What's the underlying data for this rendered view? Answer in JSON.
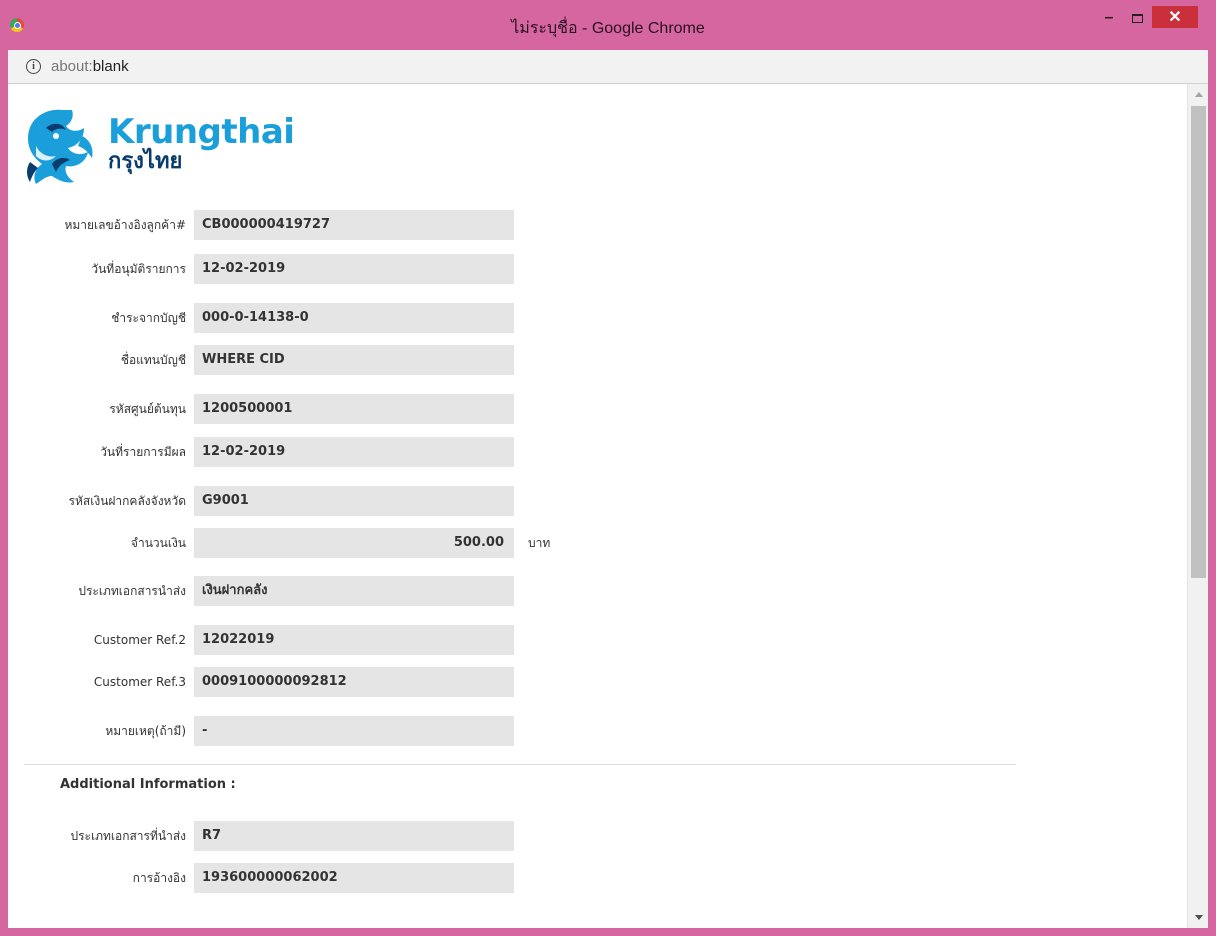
{
  "window": {
    "title": "ไม่ระบุชื่อ - Google Chrome",
    "minimize": "–",
    "close": "✕"
  },
  "address": {
    "scheme": "about:",
    "path": "blank"
  },
  "logo": {
    "name_en": "Krungthai",
    "name_th": "กรุงไทย"
  },
  "fields": [
    {
      "label": "หมายเลขอ้างอิงลูกค้า#",
      "value": "CB000000419727"
    },
    {
      "label": "วันที่อนุมัติรายการ",
      "value": "12-02-2019"
    },
    {
      "label": "ชำระจากบัญชี",
      "value": "000-0-14138-0"
    },
    {
      "label": "ชื่อแทนบัญชี",
      "value": "WHERE CID"
    },
    {
      "label": "รหัสศูนย์ต้นทุน",
      "value": "1200500001"
    },
    {
      "label": "วันที่รายการมีผล",
      "value": "12-02-2019"
    },
    {
      "label": "รหัสเงินฝากคลังจังหวัด",
      "value": "G9001"
    },
    {
      "label": "จำนวนเงิน",
      "value": "500.00",
      "unit": "บาท"
    },
    {
      "label": "ประเภทเอกสารนำส่ง",
      "value": "เงินฝากคลัง"
    },
    {
      "label": "Customer Ref.2",
      "value": "12022019"
    },
    {
      "label": "Customer Ref.3",
      "value": "0009100000092812"
    },
    {
      "label": "หมายเหตุ(ถ้ามี)",
      "value": "-"
    }
  ],
  "additional": {
    "title": "Additional Information :",
    "fields": [
      {
        "label": "ประเภทเอกสารที่นำส่ง",
        "value": "R7"
      },
      {
        "label": "การอ้างอิง",
        "value": "193600000062002"
      }
    ]
  },
  "colors": {
    "window_frame": "#d6669f",
    "brand_blue": "#1a9fdb",
    "brand_navy": "#0a3d6e",
    "field_bg": "#e5e5e5",
    "close_button": "#c9303b"
  }
}
